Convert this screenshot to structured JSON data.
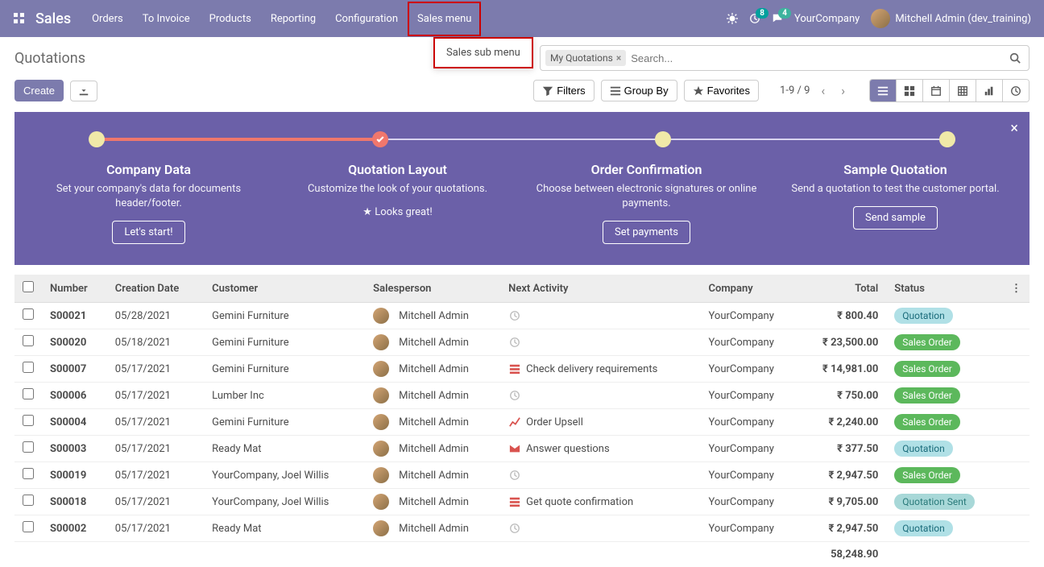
{
  "brand": "Sales",
  "nav": {
    "items": [
      "Orders",
      "To Invoice",
      "Products",
      "Reporting",
      "Configuration",
      "Sales menu"
    ],
    "submenu_label": "Sales sub menu",
    "bug_badge": "",
    "clock_badge": "8",
    "chat_badge": "4",
    "company": "YourCompany",
    "user": "Mitchell Admin (dev_training)"
  },
  "page": {
    "title": "Quotations",
    "create_label": "Create",
    "search_facet": "My Quotations",
    "search_placeholder": "Search...",
    "filters_label": "Filters",
    "groupby_label": "Group By",
    "favorites_label": "Favorites",
    "pager_text": "1-9 / 9"
  },
  "onboard": {
    "steps": [
      {
        "title": "Company Data",
        "desc": "Set your company's data for documents header/footer.",
        "action": "Let's start!"
      },
      {
        "title": "Quotation Layout",
        "desc": "Customize the look of your quotations.",
        "done_label": "Looks great!"
      },
      {
        "title": "Order Confirmation",
        "desc": "Choose between electronic signatures or online payments.",
        "action": "Set payments"
      },
      {
        "title": "Sample Quotation",
        "desc": "Send a quotation to test the customer portal.",
        "action": "Send sample"
      }
    ]
  },
  "table": {
    "headers": {
      "number": "Number",
      "creation_date": "Creation Date",
      "customer": "Customer",
      "salesperson": "Salesperson",
      "next_activity": "Next Activity",
      "company": "Company",
      "total": "Total",
      "status": "Status"
    },
    "rows": [
      {
        "number": "S00021",
        "date": "05/28/2021",
        "customer": "Gemini Furniture",
        "salesperson": "Mitchell Admin",
        "activity": "",
        "activity_type": "clock",
        "company": "YourCompany",
        "total": "₹ 800.40",
        "status": "Quotation",
        "status_class": "quotation"
      },
      {
        "number": "S00020",
        "date": "05/18/2021",
        "customer": "Gemini Furniture",
        "salesperson": "Mitchell Admin",
        "activity": "",
        "activity_type": "clock",
        "company": "YourCompany",
        "total": "₹ 23,500.00",
        "status": "Sales Order",
        "status_class": "salesorder"
      },
      {
        "number": "S00007",
        "date": "05/17/2021",
        "customer": "Gemini Furniture",
        "salesperson": "Mitchell Admin",
        "activity": "Check delivery requirements",
        "activity_type": "list-red",
        "company": "YourCompany",
        "total": "₹ 14,981.00",
        "status": "Sales Order",
        "status_class": "salesorder"
      },
      {
        "number": "S00006",
        "date": "05/17/2021",
        "customer": "Lumber Inc",
        "salesperson": "Mitchell Admin",
        "activity": "",
        "activity_type": "clock",
        "company": "YourCompany",
        "total": "₹ 750.00",
        "status": "Sales Order",
        "status_class": "salesorder"
      },
      {
        "number": "S00004",
        "date": "05/17/2021",
        "customer": "Gemini Furniture",
        "salesperson": "Mitchell Admin",
        "activity": "Order Upsell",
        "activity_type": "chart-red",
        "company": "YourCompany",
        "total": "₹ 2,240.00",
        "status": "Sales Order",
        "status_class": "salesorder"
      },
      {
        "number": "S00003",
        "date": "05/17/2021",
        "customer": "Ready Mat",
        "salesperson": "Mitchell Admin",
        "activity": "Answer questions",
        "activity_type": "mail-red",
        "company": "YourCompany",
        "total": "₹ 377.50",
        "status": "Quotation",
        "status_class": "quotation"
      },
      {
        "number": "S00019",
        "date": "05/17/2021",
        "customer": "YourCompany, Joel Willis",
        "salesperson": "Mitchell Admin",
        "activity": "",
        "activity_type": "clock",
        "company": "YourCompany",
        "total": "₹ 2,947.50",
        "status": "Sales Order",
        "status_class": "salesorder"
      },
      {
        "number": "S00018",
        "date": "05/17/2021",
        "customer": "YourCompany, Joel Willis",
        "salesperson": "Mitchell Admin",
        "activity": "Get quote confirmation",
        "activity_type": "list-red",
        "company": "YourCompany",
        "total": "₹ 9,705.00",
        "status": "Quotation Sent",
        "status_class": "quotationsent"
      },
      {
        "number": "S00002",
        "date": "05/17/2021",
        "customer": "Ready Mat",
        "salesperson": "Mitchell Admin",
        "activity": "",
        "activity_type": "clock",
        "company": "YourCompany",
        "total": "₹ 2,947.50",
        "status": "Quotation",
        "status_class": "quotation"
      }
    ],
    "footer_total": "58,248.90"
  }
}
